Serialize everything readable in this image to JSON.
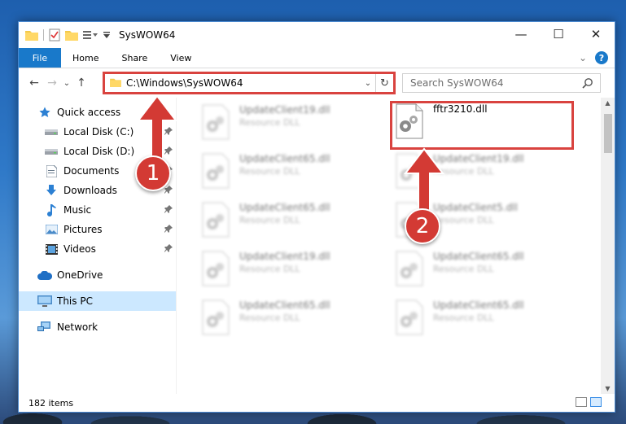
{
  "window": {
    "title": "SysWOW64",
    "controls": {
      "minimize": "—",
      "maximize": "☐",
      "close": "✕"
    }
  },
  "ribbon": {
    "tabs": [
      "File",
      "Home",
      "Share",
      "View"
    ],
    "help": "?",
    "collapse": "⌄"
  },
  "nav": {
    "back": "←",
    "forward": "→",
    "recent": "⌄",
    "up": "↑",
    "address": "C:\\Windows\\SysWOW64",
    "address_dropdown": "⌄",
    "refresh": "↻",
    "search_placeholder": "Search SysWOW64"
  },
  "sidebar": {
    "quick_access": "Quick access",
    "items": [
      {
        "label": "Local Disk (C:)",
        "icon": "drive-icon",
        "pinned": true
      },
      {
        "label": "Local Disk (D:)",
        "icon": "drive-icon",
        "pinned": true
      },
      {
        "label": "Documents",
        "icon": "documents-icon",
        "pinned": true
      },
      {
        "label": "Downloads",
        "icon": "downloads-icon",
        "pinned": true
      },
      {
        "label": "Music",
        "icon": "music-icon",
        "pinned": true
      },
      {
        "label": "Pictures",
        "icon": "pictures-icon",
        "pinned": true
      },
      {
        "label": "Videos",
        "icon": "videos-icon",
        "pinned": true
      }
    ],
    "onedrive": "OneDrive",
    "this_pc": "This PC",
    "network": "Network",
    "pin_glyph": "📌"
  },
  "files": {
    "highlighted": {
      "name": "fftr3210.dll"
    },
    "left_column": [
      {
        "name": "UpdateClient19.dll",
        "type": "Resource DLL"
      },
      {
        "name": "UpdateClient65.dll",
        "type": "Resource DLL"
      },
      {
        "name": "UpdateClient65.dll",
        "type": "Resource DLL"
      },
      {
        "name": "UpdateClient19.dll",
        "type": "Resource DLL"
      },
      {
        "name": "UpdateClient65.dll",
        "type": "Resource DLL"
      }
    ],
    "right_column": [
      {
        "name": "UpdateClient19.dll",
        "type": "Resource DLL"
      },
      {
        "name": "UpdateClient5.dll",
        "type": "Resource DLL"
      },
      {
        "name": "UpdateClient65.dll",
        "type": "Resource DLL"
      },
      {
        "name": "UpdateClient65.dll",
        "type": "Resource DLL"
      }
    ]
  },
  "status": {
    "items": "182 items"
  },
  "annotations": {
    "step1": "1",
    "step2": "2"
  },
  "colors": {
    "accent": "#1979ca",
    "highlight": "#d9433f",
    "selected": "#cce8ff"
  }
}
